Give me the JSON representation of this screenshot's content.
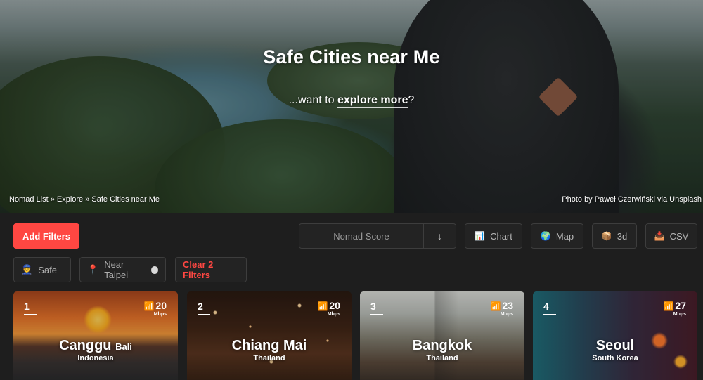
{
  "hero": {
    "title": "Safe Cities near Me",
    "subtitle_prefix": "...want to ",
    "subtitle_link": "explore more",
    "subtitle_suffix": "?",
    "breadcrumb": [
      "Nomad List",
      "Explore",
      "Safe Cities near Me"
    ],
    "breadcrumb_sep": " » ",
    "credit_prefix": "Photo by ",
    "credit_author": "Paweł Czerwiński",
    "credit_mid": " via ",
    "credit_source": "Unsplash"
  },
  "toolbar": {
    "add_filters": "Add Filters",
    "sort_label": "Nomad Score",
    "sort_direction": "↓",
    "chart_label": "Chart",
    "map_label": "Map",
    "three_d_label": "3d",
    "csv_label": "CSV",
    "icons": {
      "chart": "bar-chart-icon",
      "map": "globe-icon",
      "three_d": "box-icon",
      "csv": "inbox-tray-icon"
    }
  },
  "filters": {
    "chips": [
      {
        "label": "Safe",
        "icon": "police-officer-icon"
      },
      {
        "label": "Near Taipei",
        "icon": "pin-icon"
      }
    ],
    "clear_label": "Clear 2 Filters"
  },
  "cities": [
    {
      "rank": "1",
      "name": "Canggu",
      "region": "Bali",
      "country": "Indonesia",
      "speed": "20",
      "unit": "Mbps"
    },
    {
      "rank": "2",
      "name": "Chiang Mai",
      "region": "",
      "country": "Thailand",
      "speed": "20",
      "unit": "Mbps"
    },
    {
      "rank": "3",
      "name": "Bangkok",
      "region": "",
      "country": "Thailand",
      "speed": "23",
      "unit": "Mbps"
    },
    {
      "rank": "4",
      "name": "Seoul",
      "region": "",
      "country": "South Korea",
      "speed": "27",
      "unit": "Mbps"
    }
  ],
  "colors": {
    "accent": "#ff4742",
    "background": "#1e1e1e",
    "surface": "#232323",
    "border": "#3d3d3d"
  }
}
